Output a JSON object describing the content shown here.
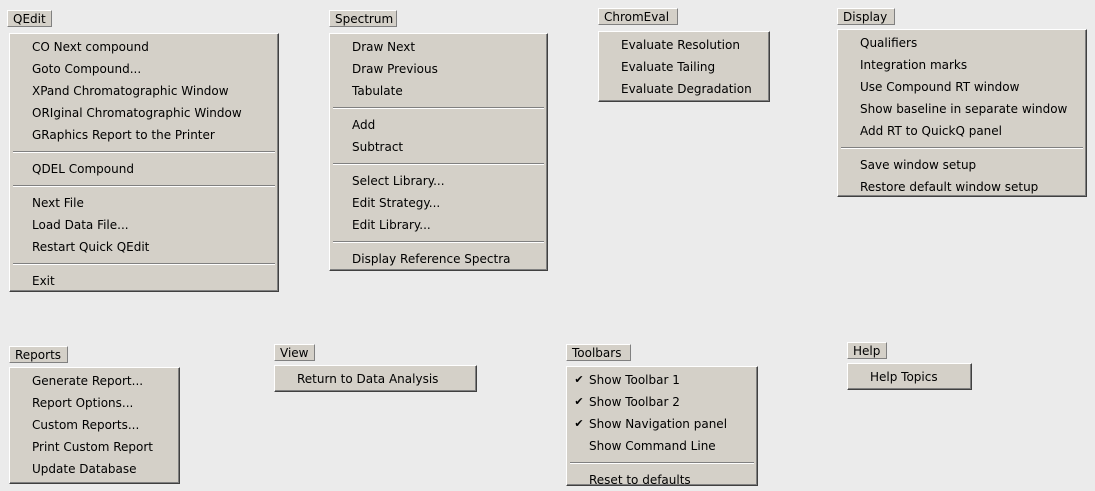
{
  "menus": {
    "qedit": {
      "title": "QEdit",
      "groups": [
        [
          "CO Next compound",
          "Goto Compound...",
          "XPand Chromatographic Window",
          "ORIginal Chromatographic Window",
          "GRaphics Report to the Printer"
        ],
        [
          "QDEL Compound"
        ],
        [
          "Next File",
          "Load Data File...",
          "Restart Quick QEdit"
        ],
        [
          "Exit"
        ]
      ]
    },
    "spectrum": {
      "title": "Spectrum",
      "groups": [
        [
          "Draw Next",
          "Draw Previous",
          "Tabulate"
        ],
        [
          "Add",
          "Subtract"
        ],
        [
          "Select Library...",
          "Edit Strategy...",
          "Edit Library..."
        ],
        [
          "Display Reference Spectra"
        ]
      ]
    },
    "chromeval": {
      "title": "ChromEval",
      "groups": [
        [
          "Evaluate Resolution",
          "Evaluate Tailing",
          "Evaluate Degradation"
        ]
      ]
    },
    "display": {
      "title": "Display",
      "groups": [
        [
          "Qualifiers",
          "Integration marks",
          "Use Compound RT window",
          "Show baseline in separate window",
          "Add RT to QuickQ panel"
        ],
        [
          "Save window setup",
          "Restore default window setup"
        ]
      ]
    },
    "reports": {
      "title": "Reports",
      "groups": [
        [
          "Generate Report...",
          "Report Options...",
          "Custom Reports...",
          "Print Custom Report",
          "Update Database"
        ]
      ]
    },
    "view": {
      "title": "View",
      "groups": [
        [
          "Return to Data Analysis"
        ]
      ]
    },
    "toolbars": {
      "title": "Toolbars",
      "groups": [
        [
          "Show Toolbar 1",
          "Show Toolbar 2",
          "Show Navigation panel",
          "Show Command Line"
        ],
        [
          "Reset to defaults"
        ]
      ],
      "checked": [
        true,
        true,
        true,
        false,
        false
      ]
    },
    "help": {
      "title": "Help",
      "groups": [
        [
          "Help Topics"
        ]
      ]
    }
  }
}
